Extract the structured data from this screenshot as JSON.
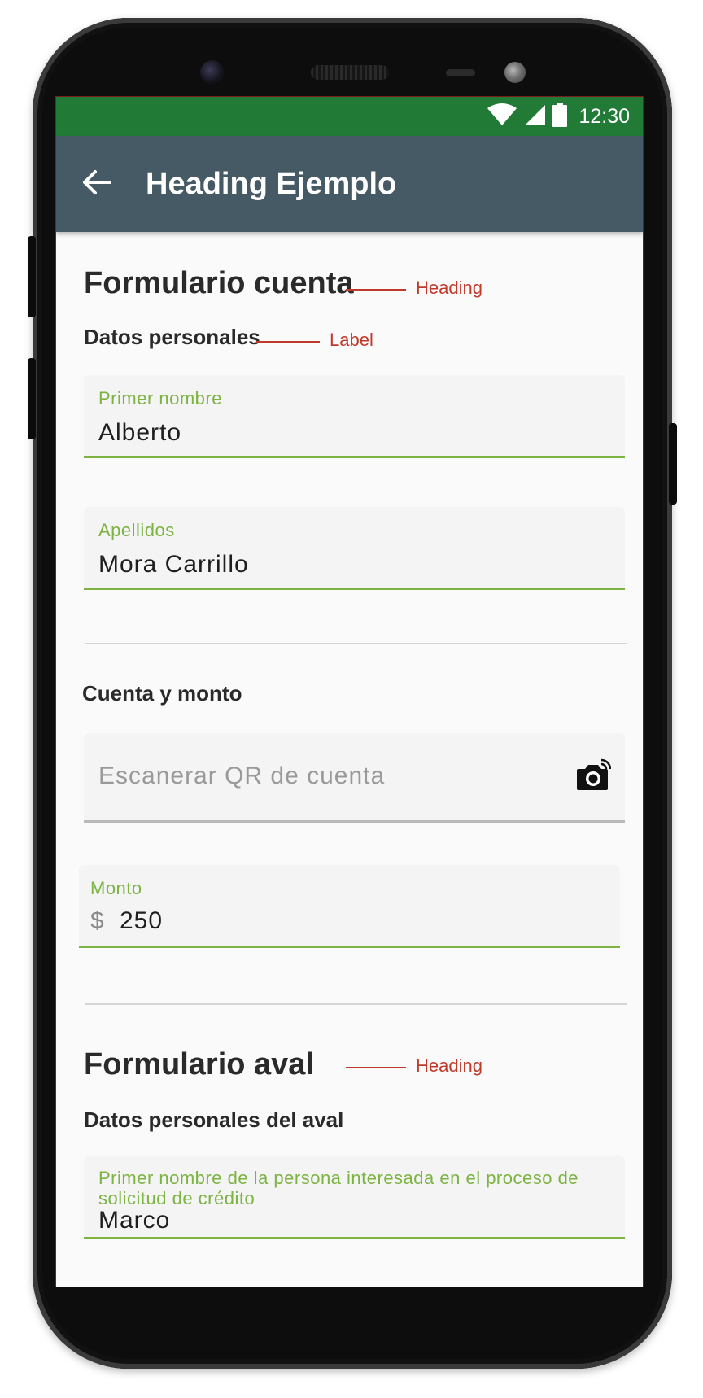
{
  "status_bar": {
    "time": "12:30",
    "icons": [
      "wifi-icon",
      "signal-icon",
      "battery-icon"
    ],
    "color": "#217b37"
  },
  "app_bar": {
    "title": "Heading Ejemplo",
    "back_icon": "arrow-back-icon",
    "color": "#455a64"
  },
  "sections": {
    "account": {
      "heading": "Formulario cuenta",
      "heading_annotation": "Heading",
      "label": "Datos personales",
      "label_annotation": "Label",
      "first_name": {
        "label": "Primer nombre",
        "value": "Alberto"
      },
      "last_name": {
        "label": "Apellidos",
        "value": "Mora Carrillo"
      }
    },
    "amount": {
      "label": "Cuenta y monto",
      "qr": {
        "placeholder": "Escanerar QR de cuenta",
        "icon": "camera-icon"
      },
      "monto": {
        "label": "Monto",
        "prefix": "$",
        "value": "250"
      }
    },
    "guarantor": {
      "heading": "Formulario aval",
      "heading_annotation": "Heading",
      "label": "Datos personales del aval",
      "first_name": {
        "label": "Primer nombre de la persona interesada en el proceso de solicitud de crédito",
        "value": "Marco"
      }
    }
  },
  "colors": {
    "accent": "#7cb342",
    "annotation": "#c0392b",
    "text": "#2a2a2a"
  }
}
